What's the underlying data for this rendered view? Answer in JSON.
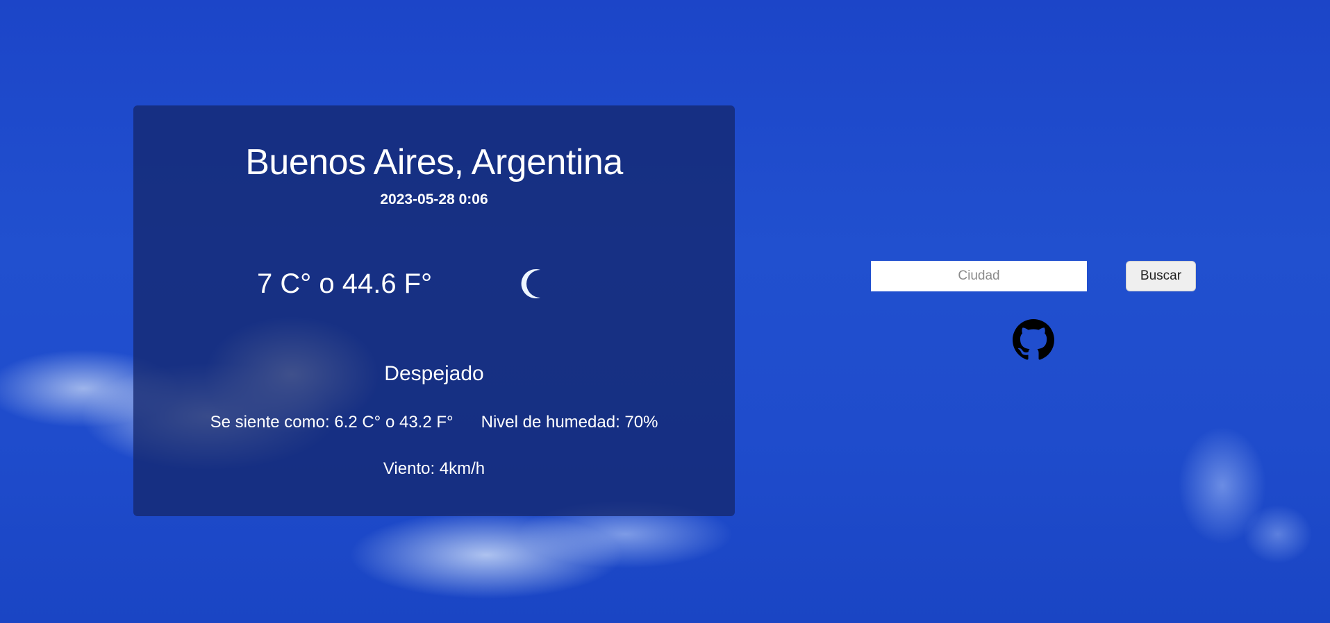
{
  "weather": {
    "location": "Buenos Aires, Argentina",
    "datetime": "2023-05-28 0:06",
    "temperature": "7 C° o 44.6 F°",
    "condition": "Despejado",
    "feels_like": "Se siente como: 6.2 C° o 43.2 F°",
    "humidity": "Nivel de humedad: 70%",
    "wind": "Viento: 4km/h",
    "icon": "moon-icon"
  },
  "search": {
    "placeholder": "Ciudad",
    "value": "",
    "button_label": "Buscar"
  },
  "links": {
    "github_icon": "github-icon"
  },
  "colors": {
    "sky_blue": "#1f4ccc",
    "card_bg": "#14286e",
    "text": "#ffffff",
    "moon": "#1565c0"
  }
}
